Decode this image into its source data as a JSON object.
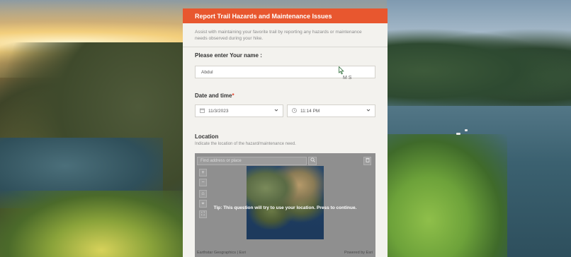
{
  "form": {
    "title": "Report Trail Hazards and Maintenance Issues",
    "description": "Assist with maintaining your favorite trail by reporting any hazards or maintenance needs observed during your hike.",
    "name_label": "Please enter Your name :",
    "name_value": "Abdul",
    "date_label": "Date and time",
    "required_mark": "*",
    "date_value": "11/3/2023",
    "time_value": "11:14 PM",
    "location_label": "Location",
    "location_hint": "Indicate the location of the hazard/maintenance need.",
    "ghost_text": "M S"
  },
  "map": {
    "search_placeholder": "Find address or place",
    "tip": "Tip: This question will try to use your location. Press to continue.",
    "attribution_left": "Earthstar Geographics | Esri",
    "attribution_right": "Powered by Esri",
    "tool_zoom_in": "+",
    "tool_zoom_out": "−",
    "tool_home": "⌂",
    "tool_locate": "⌖",
    "tool_fullscreen": "⛶"
  },
  "icons": {
    "calendar": "calendar-icon",
    "clock": "clock-icon",
    "search": "search-icon",
    "trash": "trash-icon"
  },
  "colors": {
    "header": "#e8572f",
    "required": "#e0412b"
  }
}
